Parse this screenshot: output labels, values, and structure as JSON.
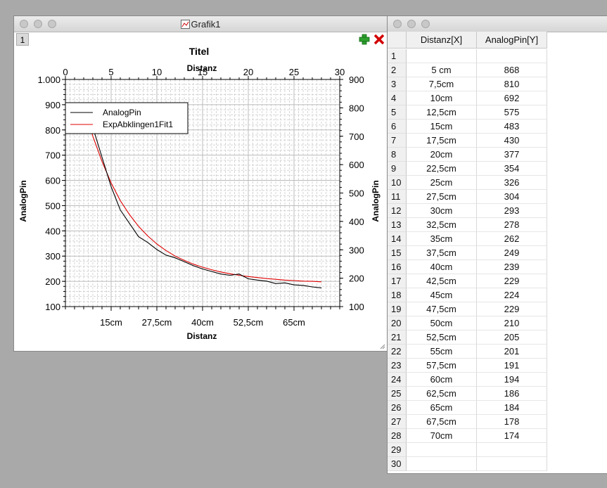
{
  "graph_window": {
    "title": "Grafik1",
    "layer_label": "1",
    "add_icon": "plus-icon",
    "remove_icon": "close-icon"
  },
  "table_window": {
    "title": "",
    "columns": [
      "Distanz[X]",
      "AnalogPin[Y]"
    ],
    "rows": [
      {
        "n": "1",
        "x": "",
        "y": ""
      },
      {
        "n": "2",
        "x": "5 cm",
        "y": "868"
      },
      {
        "n": "3",
        "x": "7,5cm",
        "y": "810"
      },
      {
        "n": "4",
        "x": "10cm",
        "y": "692"
      },
      {
        "n": "5",
        "x": "12,5cm",
        "y": "575"
      },
      {
        "n": "6",
        "x": "15cm",
        "y": "483"
      },
      {
        "n": "7",
        "x": "17,5cm",
        "y": "430"
      },
      {
        "n": "8",
        "x": "20cm",
        "y": "377"
      },
      {
        "n": "9",
        "x": "22,5cm",
        "y": "354"
      },
      {
        "n": "10",
        "x": "25cm",
        "y": "326"
      },
      {
        "n": "11",
        "x": "27,5cm",
        "y": "304"
      },
      {
        "n": "12",
        "x": "30cm",
        "y": "293"
      },
      {
        "n": "13",
        "x": "32,5cm",
        "y": "278"
      },
      {
        "n": "14",
        "x": "35cm",
        "y": "262"
      },
      {
        "n": "15",
        "x": "37,5cm",
        "y": "249"
      },
      {
        "n": "16",
        "x": "40cm",
        "y": "239"
      },
      {
        "n": "17",
        "x": "42,5cm",
        "y": "229"
      },
      {
        "n": "18",
        "x": "45cm",
        "y": "224"
      },
      {
        "n": "19",
        "x": "47,5cm",
        "y": "229"
      },
      {
        "n": "20",
        "x": "50cm",
        "y": "210"
      },
      {
        "n": "21",
        "x": "52,5cm",
        "y": "205"
      },
      {
        "n": "22",
        "x": "55cm",
        "y": "201"
      },
      {
        "n": "23",
        "x": "57,5cm",
        "y": "191"
      },
      {
        "n": "24",
        "x": "60cm",
        "y": "194"
      },
      {
        "n": "25",
        "x": "62,5cm",
        "y": "186"
      },
      {
        "n": "26",
        "x": "65cm",
        "y": "184"
      },
      {
        "n": "27",
        "x": "67,5cm",
        "y": "178"
      },
      {
        "n": "28",
        "x": "70cm",
        "y": "174"
      },
      {
        "n": "29",
        "x": "",
        "y": ""
      },
      {
        "n": "30",
        "x": "",
        "y": ""
      }
    ]
  },
  "chart_data": {
    "type": "line",
    "title": "Titel",
    "top_xlabel": "Distanz",
    "xlabel": "Distanz",
    "ylabel": "AnalogPin",
    "right_ylabel": "AnalogPin",
    "xlim": [
      0,
      30
    ],
    "ylim": [
      100,
      1000
    ],
    "right_ylim": [
      100,
      900
    ],
    "top_ticks": [
      "0",
      "5",
      "10",
      "15",
      "20",
      "25",
      "30"
    ],
    "left_ticks": [
      "100",
      "200",
      "300",
      "400",
      "500",
      "600",
      "700",
      "800",
      "900",
      "1.000"
    ],
    "right_ticks": [
      "100",
      "200",
      "300",
      "400",
      "500",
      "600",
      "700",
      "800",
      "900"
    ],
    "bottom_ticks": [
      {
        "x": 5,
        "label": "15cm"
      },
      {
        "x": 10,
        "label": "27,5cm"
      },
      {
        "x": 15,
        "label": "40cm"
      },
      {
        "x": 20,
        "label": "52,5cm"
      },
      {
        "x": 25,
        "label": "65cm"
      }
    ],
    "grid": true,
    "legend_position": "top-left",
    "series": [
      {
        "name": "AnalogPin",
        "color": "#000000",
        "x": [
          2,
          3,
          4,
          5,
          6,
          7,
          8,
          9,
          10,
          11,
          12,
          13,
          14,
          15,
          16,
          17,
          18,
          19,
          20,
          21,
          22,
          23,
          24,
          25,
          26,
          27,
          28
        ],
        "y": [
          868,
          810,
          692,
          575,
          483,
          430,
          377,
          354,
          326,
          304,
          293,
          278,
          262,
          249,
          239,
          229,
          224,
          229,
          210,
          205,
          201,
          191,
          194,
          186,
          184,
          178,
          174
        ]
      },
      {
        "name": "ExpAbklingen1Fit1",
        "color": "#e00000",
        "x": [
          2,
          3,
          4,
          5,
          6,
          7,
          8,
          9,
          10,
          11,
          12,
          13,
          14,
          15,
          16,
          17,
          18,
          19,
          20,
          21,
          22,
          23,
          24,
          25,
          26,
          27,
          28
        ],
        "y": [
          895,
          775,
          675,
          590,
          520,
          465,
          418,
          380,
          348,
          322,
          300,
          283,
          268,
          256,
          246,
          237,
          230,
          224,
          219,
          215,
          211,
          208,
          205,
          203,
          201,
          200,
          198
        ]
      }
    ]
  }
}
